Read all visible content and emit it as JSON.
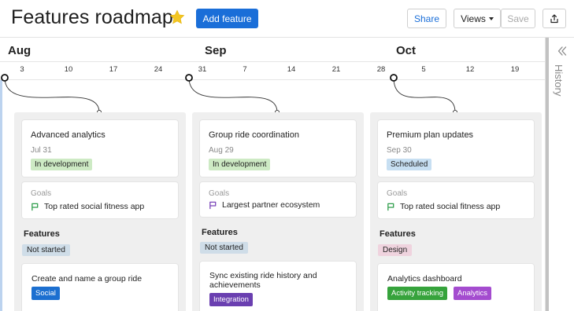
{
  "header": {
    "title": "Features roadmap",
    "add_feature_label": "Add feature",
    "share_label": "Share",
    "views_label": "Views",
    "save_label": "Save",
    "star_icon": "star-icon",
    "export_icon": "export-icon"
  },
  "timeline": {
    "months": [
      "Aug",
      "Sep",
      "Oct"
    ],
    "ticks": [
      "3",
      "10",
      "17",
      "24",
      "31",
      "7",
      "14",
      "21",
      "28",
      "5",
      "12",
      "19"
    ]
  },
  "history": {
    "label": "History",
    "collapse_icon": "double-chevron-left-icon"
  },
  "columns": [
    {
      "release": {
        "name": "Advanced analytics",
        "date": "Jul 31",
        "status": "In development"
      },
      "goals": {
        "label": "Goals",
        "goal": "Top rated social fitness app",
        "flag_color": "#2e9e4a"
      },
      "features_label": "Features",
      "feature_status": "Not started",
      "feature": {
        "title": "Create and name a group ride",
        "tags": [
          "Social"
        ]
      }
    },
    {
      "release": {
        "name": "Group ride coordination",
        "date": "Aug 29",
        "status": "In development"
      },
      "goals": {
        "label": "Goals",
        "goal": "Largest partner ecosystem",
        "flag_color": "#7a44b8"
      },
      "features_label": "Features",
      "feature_status": "Not started",
      "feature": {
        "title": "Sync existing ride history and achievements",
        "tags": [
          "Integration"
        ]
      }
    },
    {
      "release": {
        "name": "Premium plan updates",
        "date": "Sep 30",
        "status": "Scheduled"
      },
      "goals": {
        "label": "Goals",
        "goal": "Top rated social fitness app",
        "flag_color": "#2e9e4a"
      },
      "features_label": "Features",
      "feature_status": "Design",
      "feature": {
        "title": "Analytics dashboard",
        "tags": [
          "Activity tracking",
          "Analytics"
        ]
      }
    }
  ],
  "colors": {
    "primary": "#1a6ed8",
    "in_development": "#cdeac4",
    "scheduled": "#c7dff2",
    "not_started": "#cfdde8",
    "design": "#efd3de",
    "tag_social": "#1c6fd0",
    "tag_integration": "#6a3fb0",
    "tag_activity_tracking": "#36a33c",
    "tag_analytics": "#a44ccf"
  }
}
